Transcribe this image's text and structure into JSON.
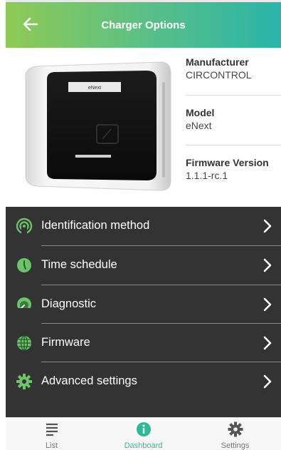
{
  "header": {
    "title": "Charger Options",
    "background_from": "#8fca56",
    "background_to": "#2ab4a9"
  },
  "charger": {
    "image_brand_text": "eNext",
    "manufacturer_label": "Manufacturer",
    "manufacturer_value": "CIRCONTROL",
    "model_label": "Model",
    "model_value": "eNext",
    "firmware_label": "Firmware Version",
    "firmware_value": "1.1.1-rc.1"
  },
  "menu": {
    "background": "#333333",
    "items": [
      {
        "label": "Identification method",
        "icon": "signal-icon"
      },
      {
        "label": "Time schedule",
        "icon": "clock-icon"
      },
      {
        "label": "Diagnostic",
        "icon": "gauge-icon"
      },
      {
        "label": "Firmware",
        "icon": "globe-icon"
      },
      {
        "label": "Advanced settings",
        "icon": "gear-icon"
      }
    ]
  },
  "bottom_nav": {
    "items": [
      {
        "label": "List",
        "icon": "list-icon",
        "active": false
      },
      {
        "label": "Dashboard",
        "icon": "info-icon",
        "active": true
      },
      {
        "label": "Settings",
        "icon": "gear-icon",
        "active": false
      }
    ],
    "active_color": "#2fb89a"
  }
}
